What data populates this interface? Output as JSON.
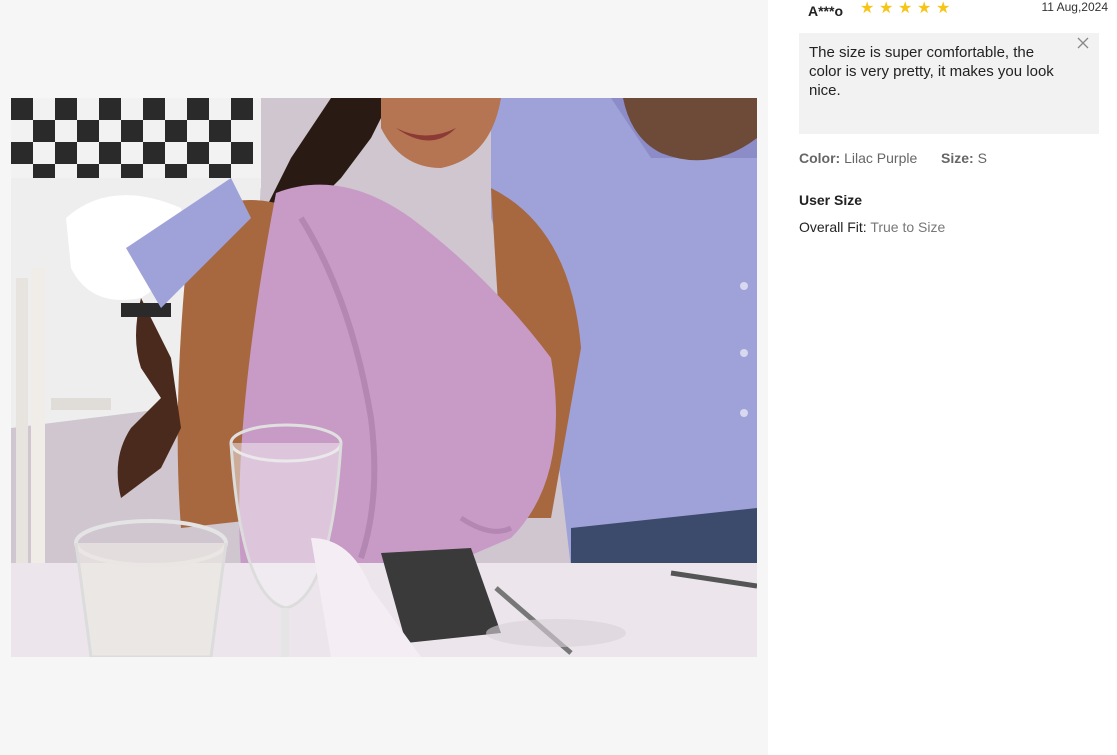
{
  "review": {
    "user": "A***o",
    "rating": 5,
    "date": "11 Aug,2024",
    "comment": "The size is super comfortable, the color is very pretty, it makes you look nice.",
    "color_label": "Color:",
    "color_value": "Lilac Purple",
    "size_label": "Size:",
    "size_value": "S",
    "user_size_title": "User Size",
    "fit_label": "Overall Fit:",
    "fit_value": "True to Size"
  },
  "colors": {
    "star": "#f5c518",
    "dress": "#c79bc5",
    "shirt": "#9fa2d8"
  },
  "icons": [
    "star-icon",
    "close-icon"
  ]
}
